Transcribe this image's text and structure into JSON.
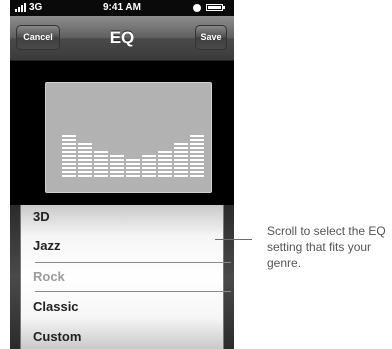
{
  "status_bar": {
    "carrier": "3G",
    "time": "9:41 AM"
  },
  "nav_bar": {
    "cancel_label": "Cancel",
    "title": "EQ",
    "save_label": "Save"
  },
  "eq_display": {
    "bar_levels": [
      11,
      9,
      7,
      6,
      5,
      6,
      7,
      9,
      11
    ]
  },
  "picker": {
    "options": [
      "3D",
      "Jazz",
      "Rock",
      "Classic",
      "Custom"
    ],
    "selected": "Rock"
  },
  "callout": {
    "text": "Scroll to select the EQ setting that fits your genre."
  }
}
